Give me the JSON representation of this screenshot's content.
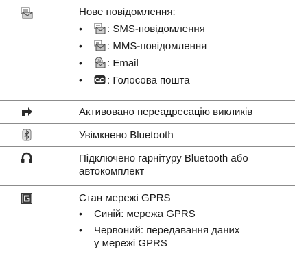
{
  "rows": [
    {
      "icon": "new-message-icon",
      "title": "Нове повідомлення:",
      "bullets": [
        {
          "icon": "sms-icon",
          "text": ": SMS-повідомлення"
        },
        {
          "icon": "mms-icon",
          "text": ": MMS-повідомлення"
        },
        {
          "icon": "email-icon",
          "text": ": Email"
        },
        {
          "icon": "voicemail-icon",
          "text": ": Голосова пошта"
        }
      ]
    },
    {
      "icon": "call-forwarding-icon",
      "title": "Активовано переадресацію викликів"
    },
    {
      "icon": "bluetooth-icon",
      "title": "Увімкнено Bluetooth"
    },
    {
      "icon": "headset-icon",
      "title": "Підключено гарнітуру Bluetooth або автокомплект"
    },
    {
      "icon": "gprs-icon",
      "title": "Стан мережі GPRS",
      "bullets": [
        {
          "text": "Синій: мережа GPRS"
        },
        {
          "text": "Червоний: передавання даних у мережі GPRS"
        }
      ]
    }
  ],
  "bullet_char": "•"
}
